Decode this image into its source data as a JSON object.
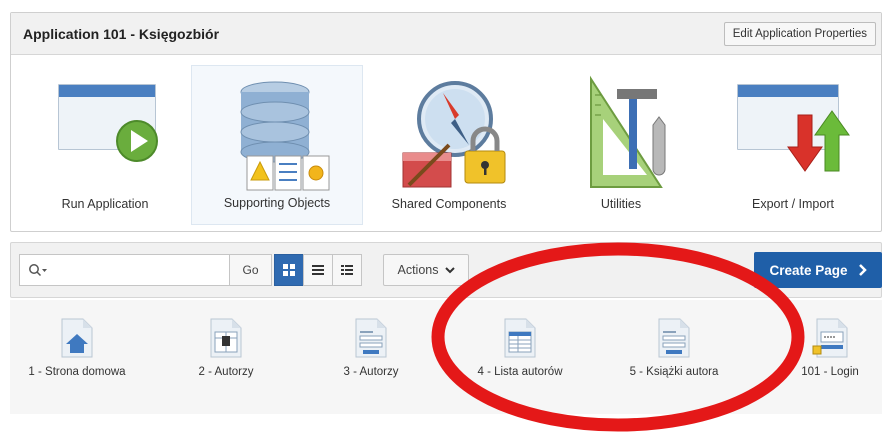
{
  "app": {
    "title": "Application 101 - Księgozbiór",
    "edit_button": "Edit Application Properties"
  },
  "tiles": [
    {
      "label": "Run Application",
      "icon": "run-application-icon"
    },
    {
      "label": "Supporting Objects",
      "icon": "supporting-objects-icon",
      "selected": true
    },
    {
      "label": "Shared Components",
      "icon": "shared-components-icon"
    },
    {
      "label": "Utilities",
      "icon": "utilities-icon"
    },
    {
      "label": "Export / Import",
      "icon": "export-import-icon"
    }
  ],
  "toolbar": {
    "search_value": "",
    "go_label": "Go",
    "actions_label": "Actions",
    "create_label": "Create Page",
    "active_view": "icons"
  },
  "pages": [
    {
      "label": "1 - Strona domowa",
      "icon": "home-page-icon"
    },
    {
      "label": "2 - Autorzy",
      "icon": "blank-page-icon"
    },
    {
      "label": "3 - Autorzy",
      "icon": "form-page-icon"
    },
    {
      "label": "4 - Lista autorów",
      "icon": "report-page-icon"
    },
    {
      "label": "5 - Książki autora",
      "icon": "form-page-icon"
    },
    {
      "label": "101 - Login",
      "icon": "login-page-icon"
    }
  ],
  "colors": {
    "accent": "#1f5fa8",
    "annotation": "#e41818",
    "header_bg": "#f1f1f1"
  }
}
